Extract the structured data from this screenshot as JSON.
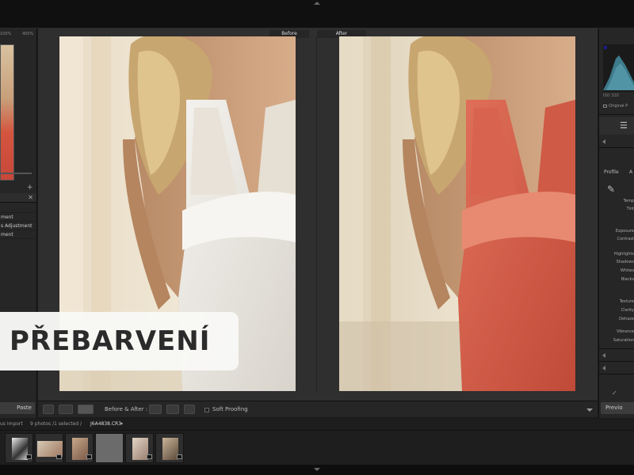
{
  "app": {
    "accent_color": "#6b6b6b"
  },
  "left_panel": {
    "zoom_left": "100%",
    "zoom_right": "400%",
    "history_items": [
      "ment",
      "s Adjustment",
      "ment"
    ],
    "paste_label": "Paste"
  },
  "compare": {
    "before_label": "Before",
    "after_label": "After"
  },
  "toolbar": {
    "mode_label": "Before & After :",
    "soft_proofing_label": "Soft Proofing"
  },
  "right_panel": {
    "histogram_meta": "ISO 320",
    "original_photo_label": "Original P",
    "profile_label": "Profile",
    "profile_value": "A",
    "rows": {
      "temp": "Temp",
      "tint": "Tint",
      "exposure": "Exposure",
      "contrast": "Contrast",
      "highlights": "Highlights",
      "shadows": "Shadows",
      "whites": "Whites",
      "blacks": "Blacks",
      "texture": "Texture",
      "clarity": "Clarity",
      "dehaze": "Dehaze",
      "vibrance": "Vibrance",
      "saturation": "Saturation"
    },
    "previous_label": "Previo"
  },
  "filmstrip": {
    "source_label": "us Import",
    "count_label": "9 photos /1 selected /",
    "filename": "J6A4838.CR3",
    "thumbnails": [
      {
        "colors": [
          "#ddd",
          "#333"
        ]
      },
      {
        "colors": [
          "#d6c9b6",
          "#a07860"
        ]
      },
      {
        "colors": [
          "#c9a78a",
          "#7a5a48"
        ]
      },
      {
        "colors": [
          "#e2d4c6",
          "#9a8070"
        ]
      },
      {
        "colors": [
          "#d9c0a8",
          "#b07060"
        ]
      },
      {
        "colors": [
          "#cbb49a",
          "#5a4838"
        ]
      }
    ]
  },
  "overlay": {
    "title": "PŘEBARVENÍ"
  }
}
